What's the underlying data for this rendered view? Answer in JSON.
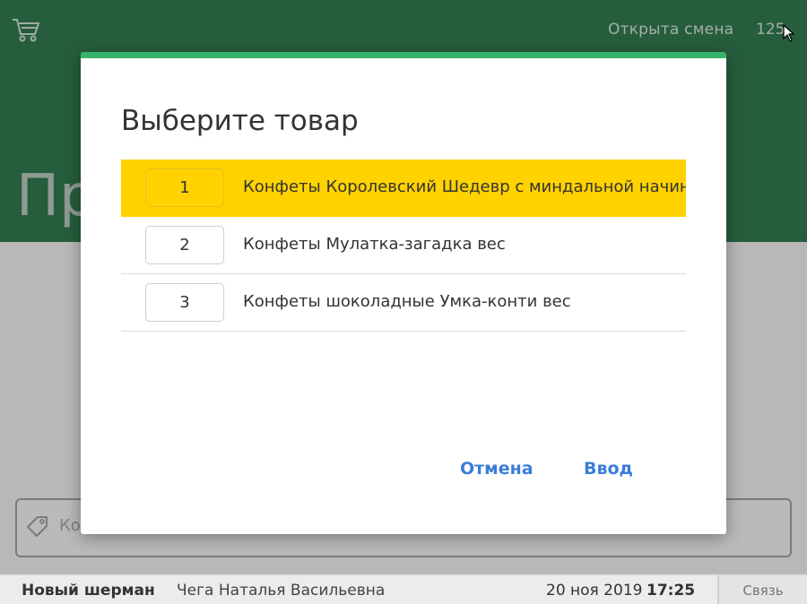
{
  "header": {
    "shift_status": "Открыта смена",
    "shift_number": "125",
    "page_heading": "Пр"
  },
  "code_field": {
    "placeholder": "Код"
  },
  "dialog": {
    "title": "Выберите товар",
    "items": [
      {
        "number": "1",
        "name": "Конфеты Королевский Шедевр с миндальной начинкой",
        "selected": true
      },
      {
        "number": "2",
        "name": "Конфеты Мулатка-загадка вес",
        "selected": false
      },
      {
        "number": "3",
        "name": "Конфеты шоколадные Умка-конти вес",
        "selected": false
      }
    ],
    "cancel_label": "Отмена",
    "enter_label": "Ввод"
  },
  "statusbar": {
    "shop": "Новый шерман",
    "cashier": "Чега Наталья Васильевна",
    "date": "20 ноя 2019",
    "time": "17:25",
    "connection": "Связь"
  },
  "colors": {
    "brand_green": "#1d6e3d",
    "accent_green": "#35b36a",
    "selection_yellow": "#ffd200",
    "link_blue": "#3b7dd8"
  }
}
